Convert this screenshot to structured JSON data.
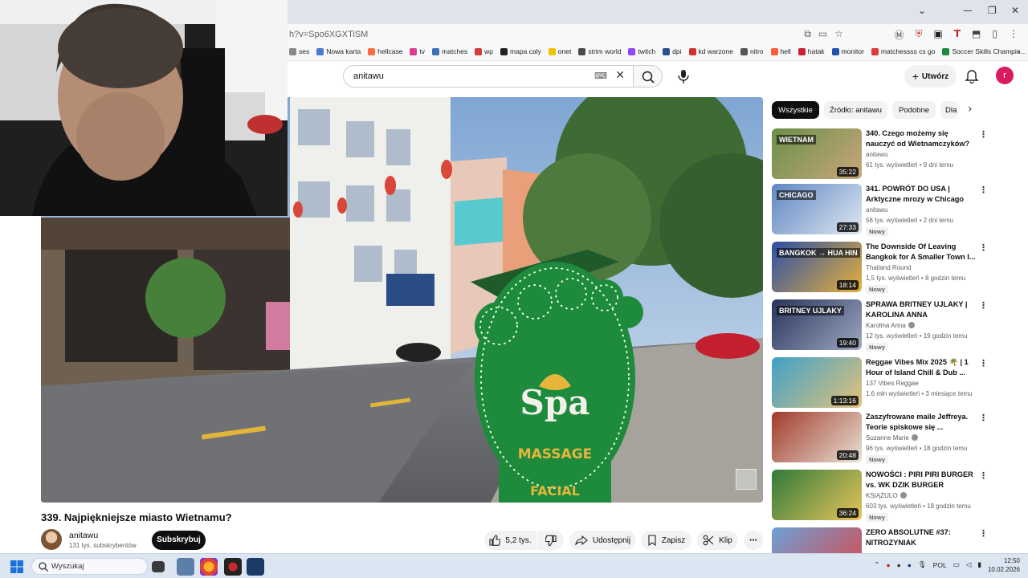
{
  "browser": {
    "url": "h?v=Spo6XGXTiSM",
    "bookmarks": [
      "ses",
      "Nowa karta",
      "hellcase",
      "tv",
      "matches",
      "wp",
      "mapa caly",
      "onet",
      "strim world",
      "twitch",
      "dpi",
      "kd warzone",
      "nitro",
      "hell",
      "hatak",
      "monitor",
      "matchessss cs go",
      "Soccer Skills Champio..."
    ],
    "bookmark_colors": [
      "#888888",
      "#4a7bd1",
      "#ff6b3d",
      "#e03a8f",
      "#3b6fb6",
      "#d23c3c",
      "#222222",
      "#f2c200",
      "#4a4a4a",
      "#9146ff",
      "#2a4f8f",
      "#d22f2f",
      "#555555",
      "#ff5a3c",
      "#cc2233",
      "#2255aa",
      "#e03a3a",
      "#1c8a3a"
    ]
  },
  "header": {
    "search_query": "anitawu",
    "create_label": "Utwórz",
    "avatar_letter": "r"
  },
  "video": {
    "title": "339. Najpiękniejsze miasto Wietnamu?",
    "sign_top": "Spa",
    "sign_mid": "MASSAGE",
    "sign_bottom": "FACIAL"
  },
  "channel": {
    "name": "anitawu",
    "subs": "131 tys. subskrybentów",
    "subscribe_label": "Subskrybuj"
  },
  "actions": {
    "likes": "5,2 tys.",
    "share": "Udostępnij",
    "save": "Zapisz",
    "clip": "Klip"
  },
  "chips": [
    "Wszystkie",
    "Źródło: anitawu",
    "Podobne",
    "Dla"
  ],
  "recommendations": [
    {
      "title": "340. Czego możemy się nauczyć od Wietnamczyków?",
      "channel": "anitawu",
      "verified": false,
      "stats": "61 tys. wyświetleń • 9 dni temu",
      "badge": "",
      "duration": "35:22",
      "thumb_text": "WIETNAM",
      "colors": [
        "#6a8f4a",
        "#c9a77a"
      ]
    },
    {
      "title": "341. POWRÓT DO USA | Arktyczne mrozy w Chicago",
      "channel": "anitawu",
      "verified": false,
      "stats": "56 tys. wyświetleń • 2 dni temu",
      "badge": "Nowy",
      "duration": "27:33",
      "thumb_text": "CHICAGO",
      "colors": [
        "#5f86c2",
        "#dfe8f2"
      ]
    },
    {
      "title": "The Downside Of Leaving Bangkok for A Smaller Town I...",
      "channel": "Thailand Round",
      "verified": false,
      "stats": "1,5 tys. wyświetleń • 8 godzin temu",
      "badge": "Nowy",
      "duration": "18:14",
      "thumb_text": "BANGKOK → HUA HIN",
      "colors": [
        "#2b4fa6",
        "#e6b13b"
      ]
    },
    {
      "title": "SPRAWA BRITNEY UJLAKY | KAROLINA ANNA",
      "channel": "Karolina Anna",
      "verified": true,
      "stats": "12 tys. wyświetleń • 19 godzin temu",
      "badge": "Nowy",
      "duration": "19:40",
      "thumb_text": "BRITNEY UJLAKY",
      "colors": [
        "#28335a",
        "#9ea8c2"
      ]
    },
    {
      "title": "Reggae Vibes Mix 2025 🌴 | 1 Hour of Island Chill & Dub ...",
      "channel": "137 Vibes Reggae",
      "verified": false,
      "stats": "1,6 mln wyświetleń • 3 miesiące temu",
      "badge": "",
      "duration": "1:13:16",
      "thumb_text": "",
      "colors": [
        "#3fa0c8",
        "#e4c27a"
      ]
    },
    {
      "title": "Zaszyfrowane maile Jeffreya. Teorie spiskowe się ...",
      "channel": "Suzanne Marie",
      "verified": true,
      "stats": "96 tys. wyświetleń • 18 godzin temu",
      "badge": "Nowy",
      "duration": "20:48",
      "thumb_text": "",
      "colors": [
        "#a03a2a",
        "#e9e2d6"
      ]
    },
    {
      "title": "NOWOŚCI : PIRI PIRI BURGER vs. WK DZIK BURGER",
      "channel": "KSIĄŻULO",
      "verified": true,
      "stats": "603 tys. wyświetleń • 18 godzin temu",
      "badge": "Nowy",
      "duration": "36:24",
      "thumb_text": "",
      "colors": [
        "#2f7a3a",
        "#e8c45a"
      ]
    },
    {
      "title": "ZERO ABSOLUTNE #37: NITROZYNIAK",
      "channel": "",
      "verified": false,
      "stats": "",
      "badge": "",
      "duration": "",
      "thumb_text": "",
      "colors": [
        "#6c9fd8",
        "#d94a4a"
      ]
    }
  ],
  "taskbar": {
    "search_placeholder": "Wyszukaj",
    "language": "POL",
    "time": "12:50",
    "date": "10.02.2026"
  }
}
